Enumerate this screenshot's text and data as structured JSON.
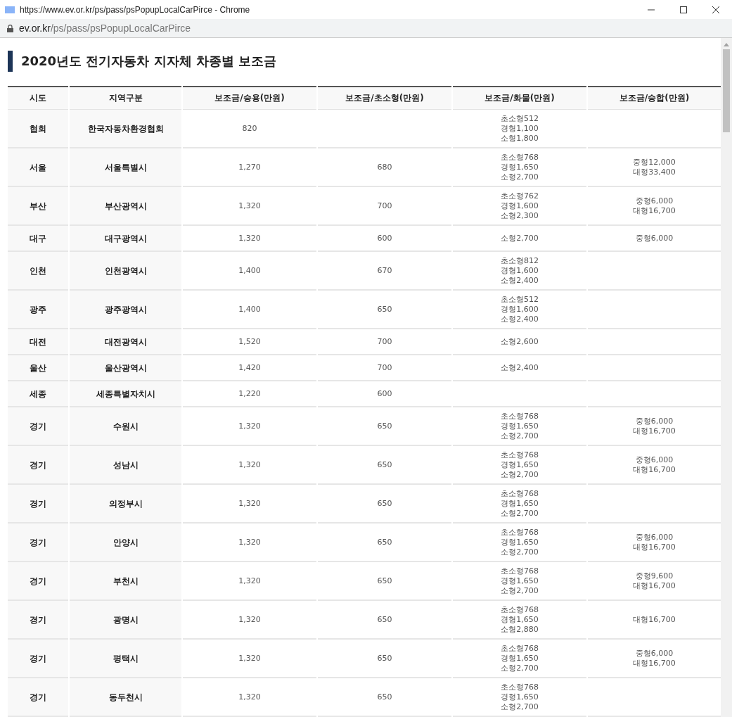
{
  "window": {
    "title": "https://www.ev.or.kr/ps/pass/psPopupLocalCarPirce - Chrome"
  },
  "address_bar": {
    "domain": "ev.or.kr",
    "path": "/ps/pass/psPopupLocalCarPirce"
  },
  "page_title": "2020년도 전기자동차 지자체 차종별 보조금",
  "table": {
    "columns": [
      "시도",
      "지역구분",
      "보조금/승용(만원)",
      "보조금/초소형(만원)",
      "보조금/화물(만원)",
      "보조금/승합(만원)"
    ],
    "rows": [
      {
        "sido": "협회",
        "region": "한국자동차환경협회",
        "sedan": "820",
        "compact": "",
        "truck": [
          "초소형512",
          "경형1,100",
          "소형1,800"
        ],
        "bus": []
      },
      {
        "sido": "서울",
        "region": "서울특별시",
        "sedan": "1,270",
        "compact": "680",
        "truck": [
          "초소형768",
          "경형1,650",
          "소형2,700"
        ],
        "bus": [
          "중형12,000",
          "대형33,400"
        ]
      },
      {
        "sido": "부산",
        "region": "부산광역시",
        "sedan": "1,320",
        "compact": "700",
        "truck": [
          "초소형762",
          "경형1,600",
          "소형2,300"
        ],
        "bus": [
          "중형6,000",
          "대형16,700"
        ]
      },
      {
        "sido": "대구",
        "region": "대구광역시",
        "sedan": "1,320",
        "compact": "600",
        "truck": [
          "소형2,700"
        ],
        "bus": [
          "중형6,000"
        ]
      },
      {
        "sido": "인천",
        "region": "인천광역시",
        "sedan": "1,400",
        "compact": "670",
        "truck": [
          "초소형812",
          "경형1,600",
          "소형2,400"
        ],
        "bus": []
      },
      {
        "sido": "광주",
        "region": "광주광역시",
        "sedan": "1,400",
        "compact": "650",
        "truck": [
          "초소형512",
          "경형1,600",
          "소형2,400"
        ],
        "bus": []
      },
      {
        "sido": "대전",
        "region": "대전광역시",
        "sedan": "1,520",
        "compact": "700",
        "truck": [
          "소형2,600"
        ],
        "bus": []
      },
      {
        "sido": "울산",
        "region": "울산광역시",
        "sedan": "1,420",
        "compact": "700",
        "truck": [
          "소형2,400"
        ],
        "bus": []
      },
      {
        "sido": "세종",
        "region": "세종특별자치시",
        "sedan": "1,220",
        "compact": "600",
        "truck": [],
        "bus": []
      },
      {
        "sido": "경기",
        "region": "수원시",
        "sedan": "1,320",
        "compact": "650",
        "truck": [
          "초소형768",
          "경형1,650",
          "소형2,700"
        ],
        "bus": [
          "중형6,000",
          "대형16,700"
        ]
      },
      {
        "sido": "경기",
        "region": "성남시",
        "sedan": "1,320",
        "compact": "650",
        "truck": [
          "초소형768",
          "경형1,650",
          "소형2,700"
        ],
        "bus": [
          "중형6,000",
          "대형16,700"
        ]
      },
      {
        "sido": "경기",
        "region": "의정부시",
        "sedan": "1,320",
        "compact": "650",
        "truck": [
          "초소형768",
          "경형1,650",
          "소형2,700"
        ],
        "bus": []
      },
      {
        "sido": "경기",
        "region": "안양시",
        "sedan": "1,320",
        "compact": "650",
        "truck": [
          "초소형768",
          "경형1,650",
          "소형2,700"
        ],
        "bus": [
          "중형6,000",
          "대형16,700"
        ]
      },
      {
        "sido": "경기",
        "region": "부천시",
        "sedan": "1,320",
        "compact": "650",
        "truck": [
          "초소형768",
          "경형1,650",
          "소형2,700"
        ],
        "bus": [
          "중형9,600",
          "대형16,700"
        ]
      },
      {
        "sido": "경기",
        "region": "광명시",
        "sedan": "1,320",
        "compact": "650",
        "truck": [
          "초소형768",
          "경형1,650",
          "소형2,880"
        ],
        "bus": [
          "대형16,700"
        ]
      },
      {
        "sido": "경기",
        "region": "평택시",
        "sedan": "1,320",
        "compact": "650",
        "truck": [
          "초소형768",
          "경형1,650",
          "소형2,700"
        ],
        "bus": [
          "중형6,000",
          "대형16,700"
        ]
      },
      {
        "sido": "경기",
        "region": "동두천시",
        "sedan": "1,320",
        "compact": "650",
        "truck": [
          "초소형768",
          "경형1,650",
          "소형2,700"
        ],
        "bus": []
      }
    ]
  }
}
